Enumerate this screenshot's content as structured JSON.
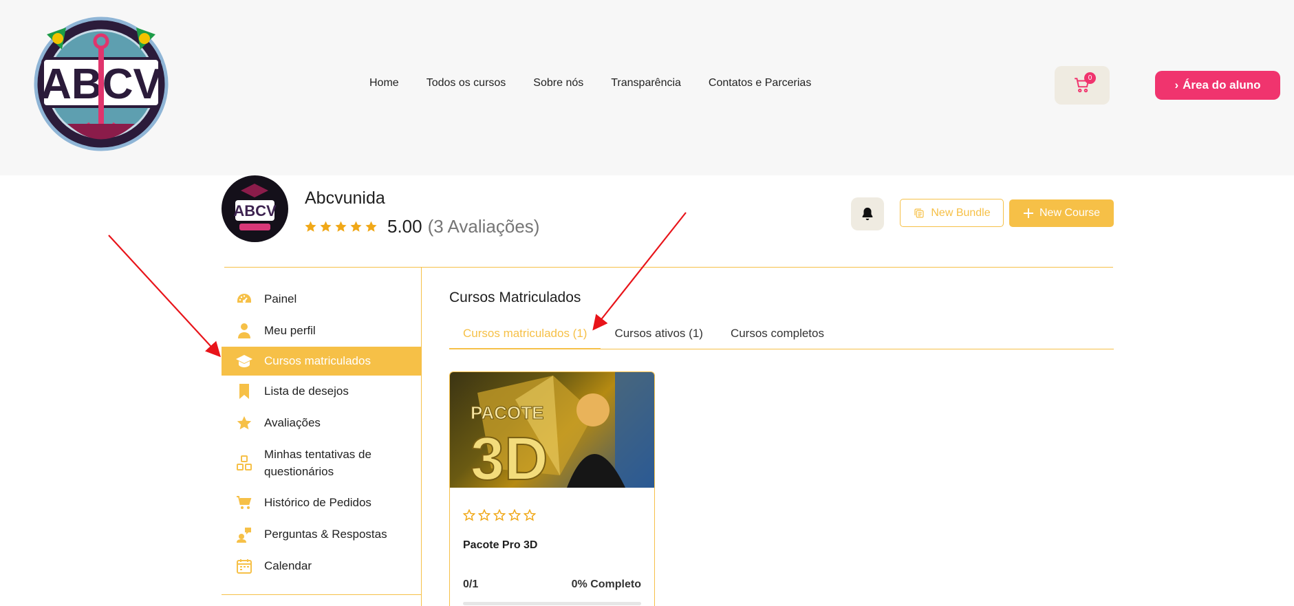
{
  "colors": {
    "accent": "#f6c047",
    "brand_pink": "#f0346e",
    "text": "#1f1f1f",
    "muted": "#757575",
    "annotation_red": "#e8141a"
  },
  "header": {
    "logo_icon": "abcv-association-logo",
    "nav": [
      "Home",
      "Todos os cursos",
      "Sobre nós",
      "Transparência",
      "Contatos e Parcerias"
    ],
    "cart_count": "0",
    "student_button": "Área do aluno",
    "student_button_icon": "chevron-right-icon"
  },
  "profile": {
    "avatar_icon": "abcv-academy-avatar",
    "name": "Abcvunida",
    "rating_value": "5.00",
    "rating_count": "(3 Avaliações)",
    "rating_stars": 5,
    "bell_icon": "bell-icon",
    "new_bundle": "New Bundle",
    "new_course": "New Course"
  },
  "sidebar": {
    "items": [
      {
        "label": "Painel",
        "icon": "dashboard-icon",
        "active": false
      },
      {
        "label": "Meu perfil",
        "icon": "user-icon",
        "active": false
      },
      {
        "label": "Cursos matriculados",
        "icon": "graduation-cap-icon",
        "active": true
      },
      {
        "label": "Lista de desejos",
        "icon": "bookmark-icon",
        "active": false
      },
      {
        "label": "Avaliações",
        "icon": "star-icon",
        "active": false
      },
      {
        "label": "Minhas tentativas de questionários",
        "icon": "quiz-icon",
        "active": false
      },
      {
        "label": "Histórico de Pedidos",
        "icon": "cart-icon",
        "active": false
      },
      {
        "label": "Perguntas & Respostas",
        "icon": "question-answer-icon",
        "active": false
      },
      {
        "label": "Calendar",
        "icon": "calendar-icon",
        "active": false
      }
    ]
  },
  "main": {
    "title": "Cursos Matriculados",
    "tabs": [
      {
        "label": "Cursos matriculados (1)",
        "active": true
      },
      {
        "label": "Cursos ativos (1)",
        "active": false
      },
      {
        "label": "Cursos completos",
        "active": false
      }
    ],
    "course": {
      "thumbnail_text_1": "PACOTE",
      "thumbnail_text_2": "3D",
      "title": "Pacote Pro 3D",
      "progress_count": "0/1",
      "progress_label": "0% Completo",
      "progress_fraction": 0,
      "rating_stars": 0
    }
  }
}
